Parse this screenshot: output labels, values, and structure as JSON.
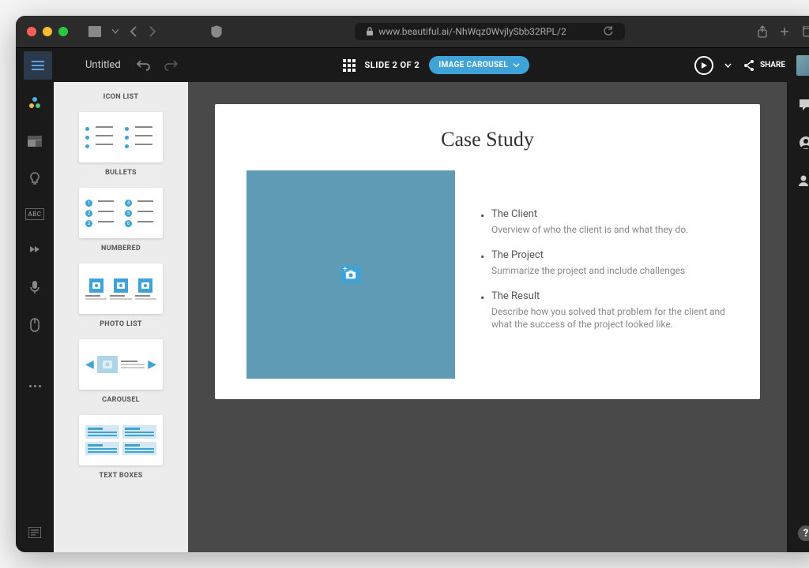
{
  "browser": {
    "url": "www.beautiful.ai/-NhWqz0WvjlySbb32RPL/2"
  },
  "toolbar": {
    "doc_title": "Untitled",
    "slide_indicator": "SLIDE 2 OF 2",
    "template_pill": "IMAGE CAROUSEL",
    "share_label": "SHARE"
  },
  "left_rail_abc": "ABC",
  "templates": [
    {
      "label": "ICON LIST"
    },
    {
      "label": "BULLETS"
    },
    {
      "label": "NUMBERED"
    },
    {
      "label": "PHOTO LIST"
    },
    {
      "label": "CAROUSEL"
    },
    {
      "label": "TEXT BOXES"
    }
  ],
  "slide": {
    "title": "Case Study",
    "items": [
      {
        "title": "The Client",
        "desc": "Overview of who the client is and what they do."
      },
      {
        "title": "The Project",
        "desc": "Summarize the project and include challenges"
      },
      {
        "title": "The Result",
        "desc": "Describe how you solved that problem for the client and what the success of the project looked like."
      }
    ]
  }
}
